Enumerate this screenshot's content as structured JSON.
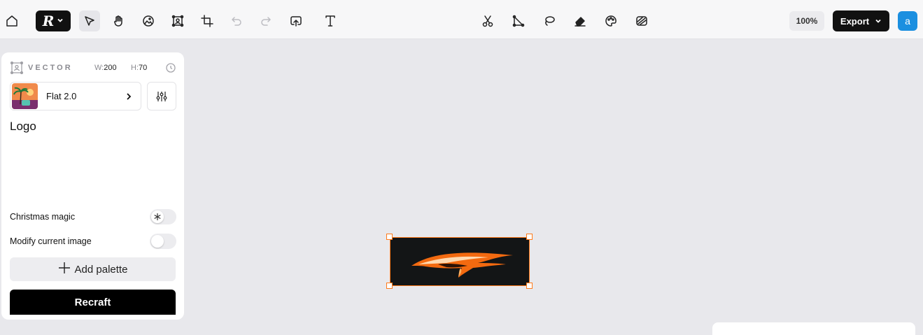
{
  "toolbar": {
    "tools": [
      {
        "name": "home-icon",
        "active": false,
        "disabled": false
      },
      {
        "name": "select-icon",
        "active": true,
        "disabled": false
      },
      {
        "name": "hand-icon",
        "active": false,
        "disabled": false
      },
      {
        "name": "image-icon",
        "active": false,
        "disabled": false
      },
      {
        "name": "frame-icon",
        "active": false,
        "disabled": false
      },
      {
        "name": "crop-icon",
        "active": false,
        "disabled": false
      },
      {
        "name": "undo-icon",
        "active": false,
        "disabled": true
      },
      {
        "name": "redo-icon",
        "active": false,
        "disabled": true
      },
      {
        "name": "upload-icon",
        "active": false,
        "disabled": false
      },
      {
        "name": "text-icon",
        "active": false,
        "disabled": false
      },
      {
        "name": "scissors-icon",
        "active": false,
        "disabled": false
      },
      {
        "name": "vector-edit-icon",
        "active": false,
        "disabled": false
      },
      {
        "name": "lasso-icon",
        "active": false,
        "disabled": false
      },
      {
        "name": "eraser-icon",
        "active": false,
        "disabled": false
      },
      {
        "name": "palette-icon",
        "active": false,
        "disabled": false
      },
      {
        "name": "remove-bg-icon",
        "active": false,
        "disabled": false
      }
    ],
    "brand": {
      "logo": "R",
      "icon": "chevron-down-icon"
    },
    "zoom": "100%",
    "export_label": "Export",
    "avatar_letter": "a"
  },
  "panel": {
    "type_label": "VECTOR",
    "width_label": "W:",
    "width_value": "200",
    "height_label": "H:",
    "height_value": "70",
    "style_name": "Flat 2.0",
    "prompt": "Logo",
    "options": [
      {
        "label": "Christmas magic",
        "on": false
      },
      {
        "label": "Modify current image",
        "on": false
      }
    ],
    "add_palette_label": "Add palette",
    "recraft_label": "Recraft"
  },
  "colors": {
    "accent": "#ff7a1a",
    "avatar": "#1b8fe0",
    "canvas_bg": "#e8e8ec",
    "logo_bg": "#131516"
  }
}
